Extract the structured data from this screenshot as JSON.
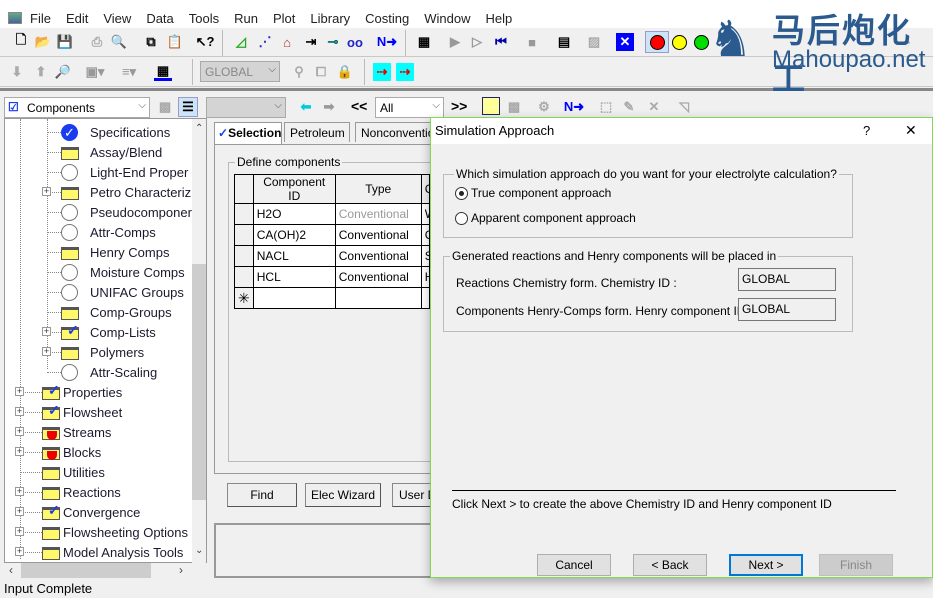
{
  "menu": [
    "File",
    "Edit",
    "View",
    "Data",
    "Tools",
    "Run",
    "Plot",
    "Library",
    "Costing",
    "Window",
    "Help"
  ],
  "toolbar2": {
    "global_combo": "GLOBAL"
  },
  "browser_toolbar": {
    "form_combo": "Components",
    "filter_combo": "All",
    "prev": "<<",
    "next": ">>"
  },
  "tree": {
    "children": [
      "Specifications",
      "Assay/Blend",
      "Light-End Proper",
      "Petro Characteriz",
      "Pseudocomponer",
      "Attr-Comps",
      "Henry Comps",
      "Moisture Comps",
      "UNIFAC Groups",
      "Comp-Groups",
      "Comp-Lists",
      "Polymers",
      "Attr-Scaling"
    ],
    "top": [
      "Properties",
      "Flowsheet",
      "Streams",
      "Blocks",
      "Utilities",
      "Reactions",
      "Convergence",
      "Flowsheeting Options",
      "Model Analysis Tools"
    ]
  },
  "form": {
    "tabs": [
      "Selection",
      "Petroleum",
      "Nonconventio"
    ],
    "group_label": "Define components",
    "columns": [
      "Component ID",
      "Type",
      "C"
    ],
    "rows": [
      [
        "H2O",
        "Conventional",
        "W"
      ],
      [
        "CA(OH)2",
        "Conventional",
        "CA"
      ],
      [
        "NACL",
        "Conventional",
        "SO"
      ],
      [
        "HCL",
        "Conventional",
        "HY"
      ]
    ],
    "new_row_marker": "✳",
    "buttons": [
      "Find",
      "Elec Wizard",
      "User D"
    ]
  },
  "status": "Input Complete",
  "dialog": {
    "title": "Simulation Approach",
    "help": "?",
    "close": "✕",
    "question": "Which simulation approach do you want for your electrolyte calculation?",
    "options": [
      {
        "label": "True component approach",
        "selected": true
      },
      {
        "label": "Apparent component approach",
        "selected": false
      }
    ],
    "placed_label": "Generated reactions and Henry components will be placed in",
    "chem_label": "Reactions Chemistry form. Chemistry ID :",
    "chem_value": "GLOBAL",
    "henry_label": "Components Henry-Comps form. Henry component ID :",
    "henry_value": "GLOBAL",
    "hint": "Click Next > to create the above Chemistry ID and Henry component ID",
    "buttons": {
      "cancel": "Cancel",
      "back": "< Back",
      "next": "Next >",
      "finish": "Finish"
    }
  },
  "watermark": {
    "cn": "马后炮化工",
    "en": "Mahoupao.net"
  },
  "colors": {
    "accent": "#0078d7",
    "dialog_border": "#7ed957",
    "check": "#1a3cf0"
  }
}
